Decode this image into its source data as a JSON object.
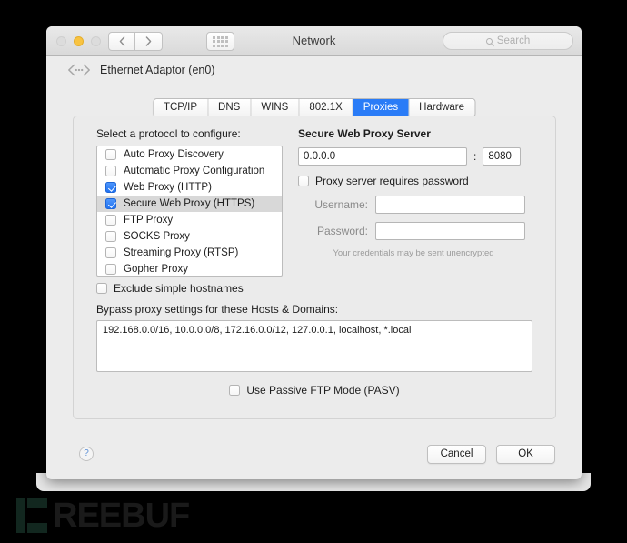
{
  "window": {
    "title": "Network",
    "traffic_lights": [
      "close-grey",
      "minimize-amber",
      "zoom-grey"
    ],
    "nav_back_icon": "chevron-left-icon",
    "nav_forward_icon": "chevron-right-icon",
    "grid_icon": "grid-apps-icon"
  },
  "search": {
    "placeholder": "Search",
    "icon": "search-icon"
  },
  "adapter": {
    "icon": "ethernet-icon",
    "name": "Ethernet Adaptor (en0)"
  },
  "tabs": [
    {
      "label": "TCP/IP",
      "active": false
    },
    {
      "label": "DNS",
      "active": false
    },
    {
      "label": "WINS",
      "active": false
    },
    {
      "label": "802.1X",
      "active": false
    },
    {
      "label": "Proxies",
      "active": true
    },
    {
      "label": "Hardware",
      "active": false
    }
  ],
  "protocols": {
    "label": "Select a protocol to configure:",
    "items": [
      {
        "label": "Auto Proxy Discovery",
        "checked": false,
        "selected": false
      },
      {
        "label": "Automatic Proxy Configuration",
        "checked": false,
        "selected": false
      },
      {
        "label": "Web Proxy (HTTP)",
        "checked": true,
        "selected": false
      },
      {
        "label": "Secure Web Proxy (HTTPS)",
        "checked": true,
        "selected": true
      },
      {
        "label": "FTP Proxy",
        "checked": false,
        "selected": false
      },
      {
        "label": "SOCKS Proxy",
        "checked": false,
        "selected": false
      },
      {
        "label": "Streaming Proxy (RTSP)",
        "checked": false,
        "selected": false
      },
      {
        "label": "Gopher Proxy",
        "checked": false,
        "selected": false
      }
    ]
  },
  "exclude_simple_hostnames": {
    "label": "Exclude simple hostnames",
    "checked": false
  },
  "bypass": {
    "label": "Bypass proxy settings for these Hosts & Domains:",
    "value": "192.168.0.0/16, 10.0.0.0/8, 172.16.0.0/12, 127.0.0.1, localhost, *.local"
  },
  "passive_ftp": {
    "label": "Use Passive FTP Mode (PASV)",
    "checked": false
  },
  "server": {
    "title": "Secure Web Proxy Server",
    "host_value": "0.0.0.0",
    "host_placeholder": "",
    "separator": ":",
    "port_value": "8080",
    "requires_password_label": "Proxy server requires password",
    "requires_password_checked": false,
    "username_label": "Username:",
    "username_value": "",
    "password_label": "Password:",
    "password_value": "",
    "note": "Your credentials may be sent unencrypted"
  },
  "footer": {
    "help_label": "?",
    "cancel_label": "Cancel",
    "ok_label": "OK"
  },
  "watermark": {
    "text": "REEBUF"
  },
  "colors": {
    "accent_blue": "#2a7cf7",
    "checkbox_blue": "#2173f2",
    "selected_row": "#d8d8d8",
    "window_bg": "#ececec",
    "panel_bg": "#ebebeb",
    "backdrop": "#000000"
  }
}
